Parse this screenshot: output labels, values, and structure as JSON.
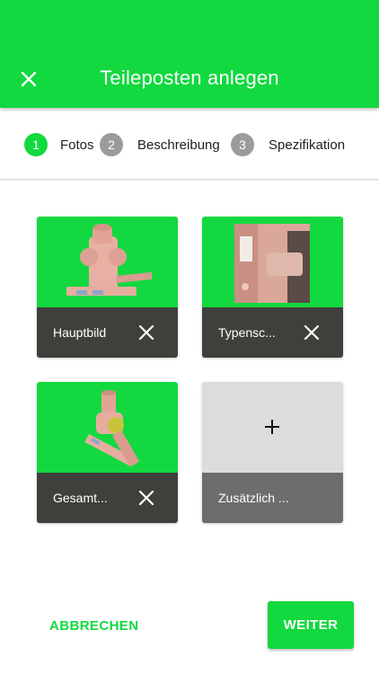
{
  "header": {
    "title": "Teileposten anlegen",
    "close_icon": "close-icon"
  },
  "stepper": {
    "steps": [
      {
        "number": "1",
        "label": "Fotos",
        "state": "active"
      },
      {
        "number": "2",
        "label": "Beschreibung",
        "state": "inactive"
      },
      {
        "number": "3",
        "label": "Spezifikation",
        "state": "inactive"
      }
    ]
  },
  "photos": [
    {
      "label": "Hauptbild",
      "has_image": true
    },
    {
      "label": "Typensc...",
      "has_image": true
    },
    {
      "label": "Gesamt...",
      "has_image": true
    },
    {
      "label": "Zusätzlich ...",
      "has_image": false
    }
  ],
  "actions": {
    "cancel_label": "ABBRECHEN",
    "next_label": "WEITER"
  },
  "colors": {
    "accent": "#12d93f",
    "tile_bar": "#3f3f3c",
    "step_inactive": "#9b9b9b",
    "empty_tile": "#dcdcdc"
  }
}
